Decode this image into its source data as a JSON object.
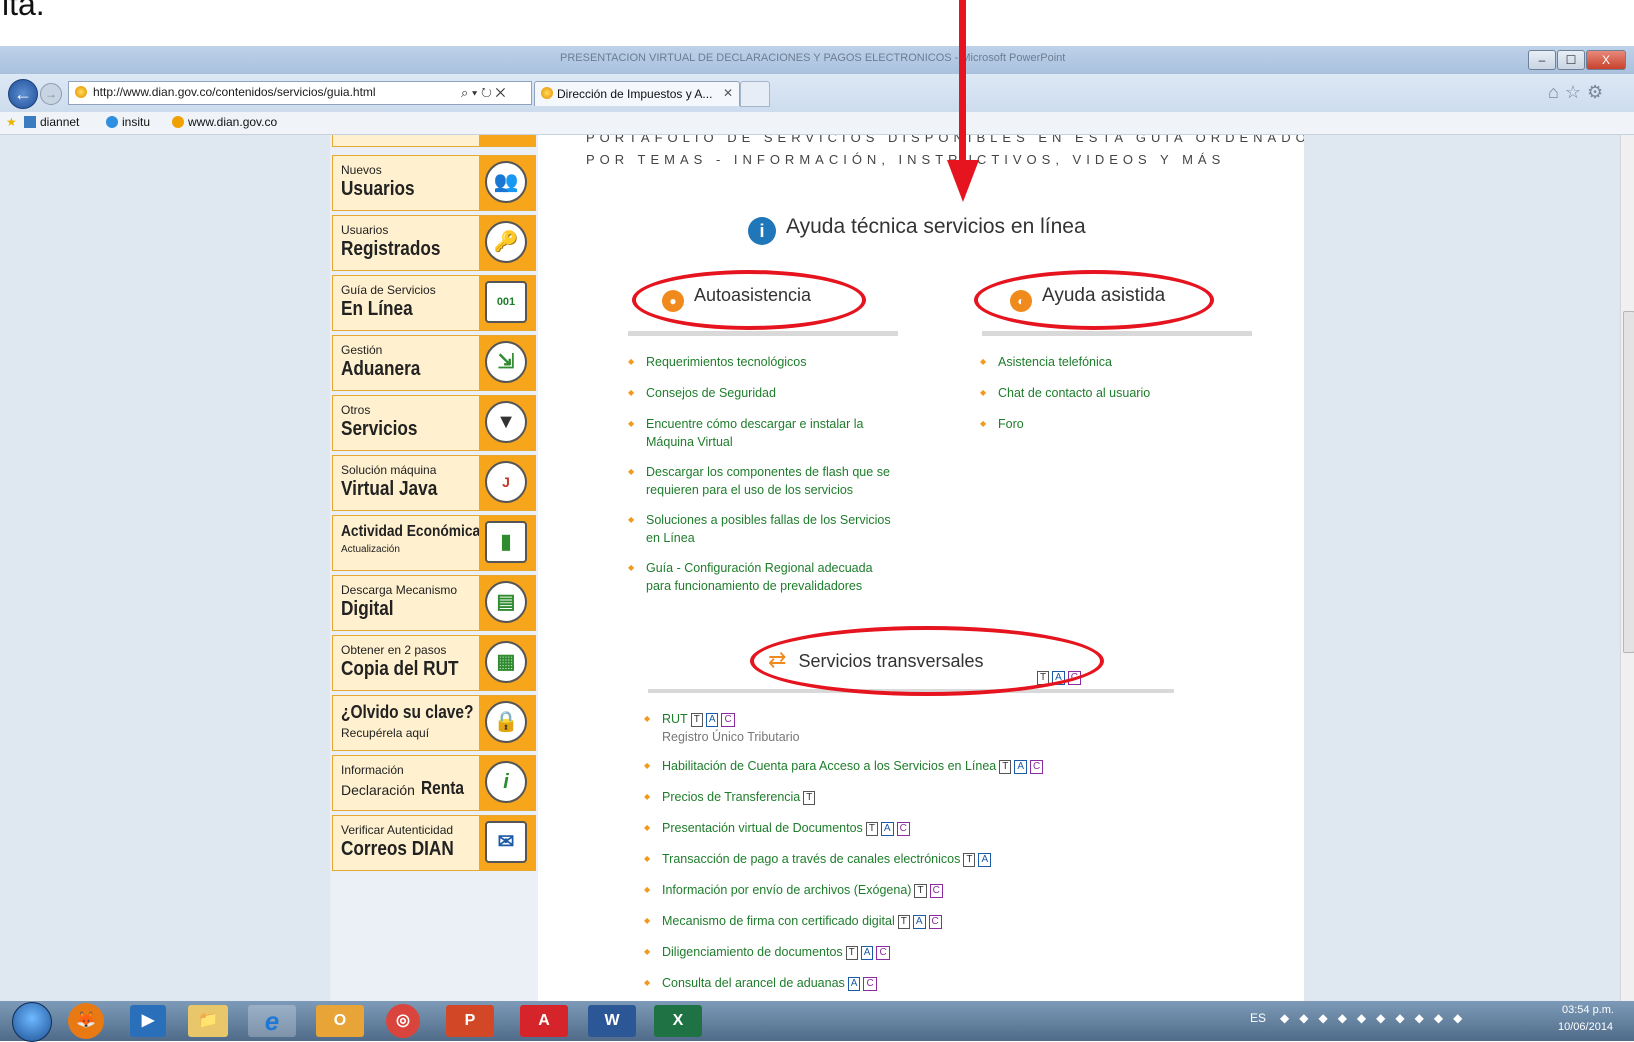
{
  "slide_fragment": "ita.",
  "window": {
    "title": "PRESENTACION VIRTUAL DE DECLARACIONES Y PAGOS ELECTRONICOS - Microsoft PowerPoint",
    "url": "http://www.dian.gov.co/contenidos/servicios/guia.html",
    "address_icons": "⌕ ▾ ↻ ✕",
    "tab_label": "Dirección de Impuestos y A...",
    "tab_close": "✕",
    "right_icons": "⌂☆⚙",
    "min": "–",
    "max": "☐",
    "close": "X"
  },
  "favorites": [
    {
      "label": "diannet"
    },
    {
      "label": "insitu"
    },
    {
      "label": "www.dian.gov.co"
    }
  ],
  "sidebar": {
    "items": [
      {
        "small": "Nuevos",
        "big": "Usuarios",
        "icon": "👥"
      },
      {
        "small": "Usuarios",
        "big": "Registrados",
        "icon": "🔑"
      },
      {
        "small": "Guía de Servicios",
        "big": "En Línea",
        "icon": "001"
      },
      {
        "small": "Gestión",
        "big": "Aduanera",
        "icon": "⇲"
      },
      {
        "small": "Otros",
        "big": "Servicios",
        "icon": "▼"
      },
      {
        "small": "Solución máquina",
        "big": "Virtual Java",
        "icon": "J"
      },
      {
        "big_first": "Actividad Económica",
        "small_after": "Actualización",
        "icon": "▮"
      },
      {
        "small": "Descarga Mecanismo",
        "big": "Digital",
        "icon": "▤"
      },
      {
        "small": "Obtener en 2 pasos",
        "big": "Copia del RUT",
        "icon": "▦"
      },
      {
        "big_first": "¿Olvido su clave?",
        "small_after": "Recupérela aquí",
        "icon": "🔒"
      },
      {
        "small": "Información",
        "small2": "Declaración",
        "big_inline": "Renta",
        "icon": "i"
      },
      {
        "small": "Verificar Autenticidad",
        "big": "Correos DIAN",
        "icon": "✉"
      }
    ]
  },
  "main": {
    "portfolio_line1": "PORTAFOLIO DE SERVICIOS DISPONIBLES EN ESTA GUÍA ORDENADOS",
    "portfolio_line2": "POR TEMAS - INFORMACIÓN, INSTRUCTIVOS, VIDEOS Y MÁS",
    "help_heading": "Ayuda técnica servicios en línea",
    "autoasistencia": {
      "title": "Autoasistencia",
      "items": [
        "Requerimientos tecnológicos",
        "Consejos de Seguridad",
        "Encuentre cómo descargar e instalar la",
        "Máquina Virtual",
        "Descargar los componentes de flash que se",
        "requieren para el uso de los servicios",
        "Soluciones a posibles fallas de los Servicios",
        "en Línea",
        "Guía - Configuración Regional adecuada",
        "para funcionamiento de prevalidadores"
      ]
    },
    "ayuda_asistida": {
      "title": "Ayuda asistida",
      "items": [
        "Asistencia telefónica",
        "Chat de contacto al usuario",
        "Foro"
      ]
    },
    "transversales": {
      "title": "Servicios transversales",
      "tag_t": "T",
      "tag_a": "A",
      "tag_c": "C",
      "items": [
        "RUT",
        "Habilitación de Cuenta para Acceso a los Servicios en Línea",
        "Precios de Transferencia",
        "Presentación virtual de Documentos",
        "Transacción de pago a través de canales electrónicos",
        "Información por envío de archivos (Exógena)",
        "Mecanismo de firma con certificado digital",
        "Diligenciamiento de documentos",
        "Consulta del arancel de aduanas"
      ],
      "rut_sub": "Registro Único Tributario"
    }
  },
  "taskbar": {
    "apps": [
      "🦊",
      "▶",
      "📁",
      "e",
      "O",
      "◎",
      "P",
      "A",
      "W",
      "X"
    ],
    "tray": "ES",
    "time": "03:54 p.m.",
    "date": "10/06/2014"
  },
  "colors": {
    "accent_orange": "#f7a51a",
    "link_green": "#1e7d2b",
    "annotation_red": "#e5141e"
  }
}
